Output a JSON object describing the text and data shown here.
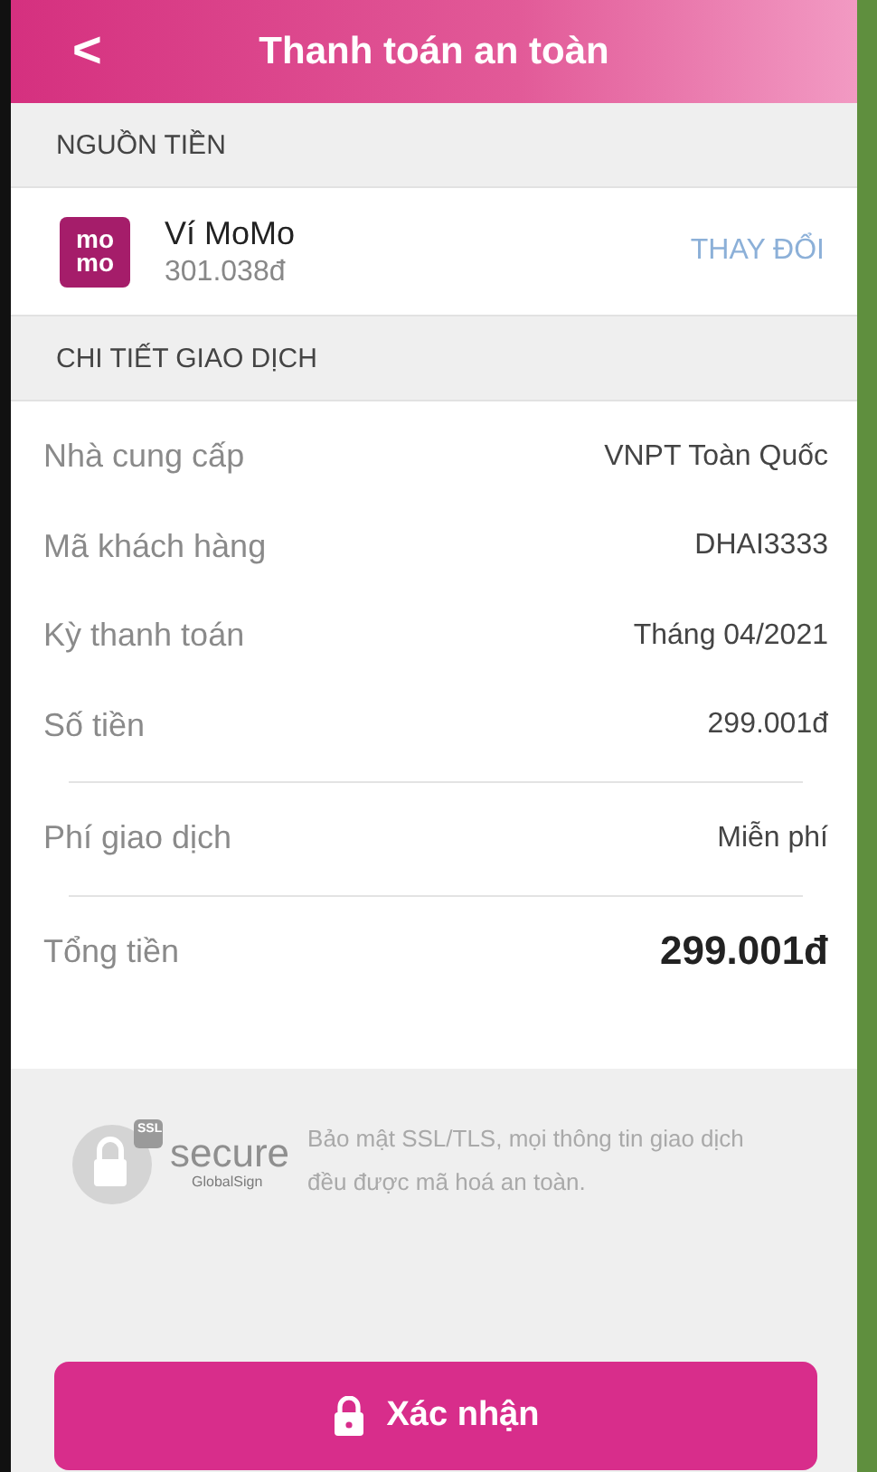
{
  "header": {
    "back": "<",
    "title": "Thanh toán an toàn"
  },
  "source": {
    "heading": "NGUỒN TIỀN",
    "logo": [
      "mo",
      "mo"
    ],
    "name": "Ví MoMo",
    "balance": "301.038đ",
    "action": "THAY ĐỔI"
  },
  "details": {
    "heading": "CHI TIẾT GIAO DỊCH",
    "groups": [
      [
        {
          "kind": "normal",
          "label": "Nhà cung cấp",
          "value": "VNPT Toàn Quốc"
        },
        {
          "kind": "normal",
          "label": "Mã khách hàng",
          "value": "DHAI3333"
        },
        {
          "kind": "normal",
          "label": "Kỳ thanh toán",
          "value": "Tháng 04/2021"
        },
        {
          "kind": "normal",
          "label": "Số tiền",
          "value": "299.001đ"
        }
      ],
      [
        {
          "kind": "normal",
          "label": "Phí giao dịch",
          "value": "Miễn phí"
        }
      ],
      [
        {
          "kind": "total",
          "label": "Tổng tiền",
          "value": "299.001đ"
        }
      ]
    ]
  },
  "security": {
    "badge": {
      "ssl": "SSL",
      "word": "secure",
      "brand": "GlobalSign"
    },
    "note": "Bảo mật SSL/TLS, mọi thông tin giao dịch đều được mã hoá an toàn."
  },
  "confirm_button": "Xác nhận"
}
